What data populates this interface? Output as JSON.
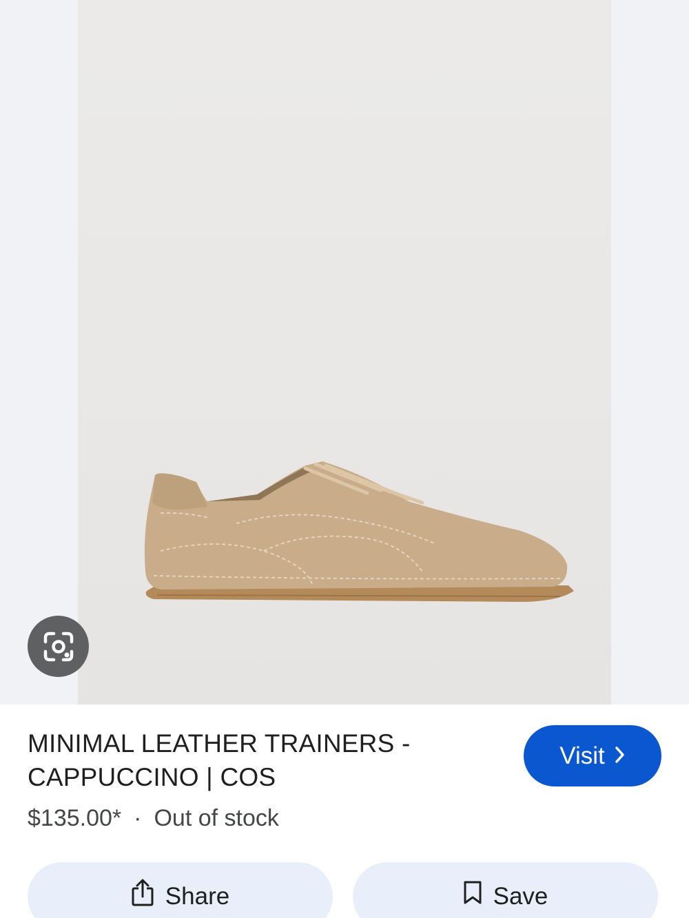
{
  "product": {
    "title_line1": "MINIMAL LEATHER TRAINERS -",
    "title_line2": "CAPPUCCINO | COS",
    "price": "$135.00*",
    "separator": "·",
    "stock_status": "Out of stock",
    "image_icon": "suede-sneaker-image"
  },
  "actions": {
    "visit_label": "Visit",
    "visit_icon": "chevron-right-icon",
    "share_label": "Share",
    "share_icon": "share-icon",
    "save_label": "Save",
    "save_icon": "bookmark-icon",
    "lens_icon": "lens-icon"
  },
  "colors": {
    "accent": "#0b57d0",
    "action_bg": "#e8eefa",
    "lens_bg": "#5f6062",
    "shoe": "#c9ad8a"
  }
}
